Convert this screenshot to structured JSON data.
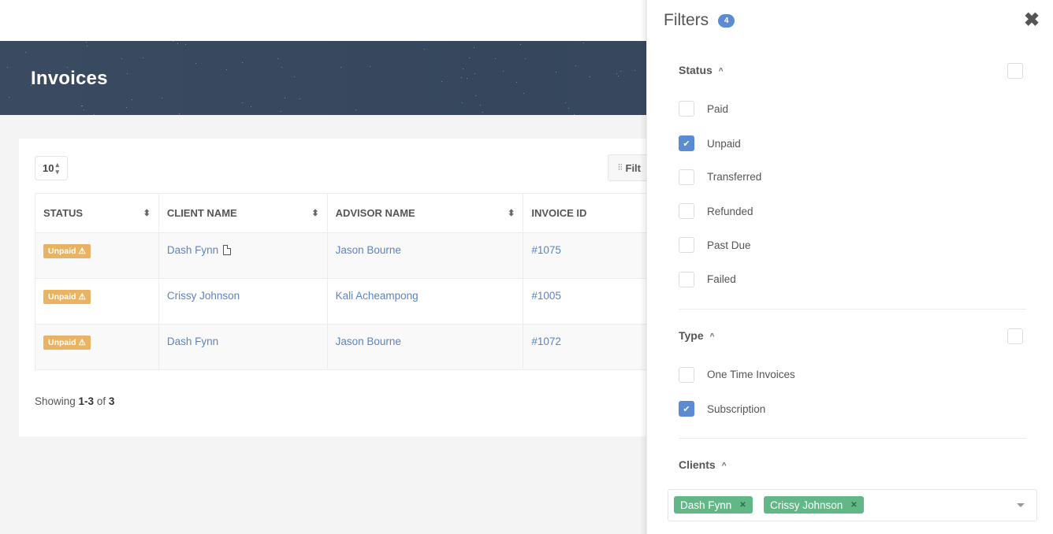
{
  "header": {
    "title": "Invoices"
  },
  "toolbar": {
    "per_page": "10",
    "filter_label": "Filt"
  },
  "table": {
    "columns": [
      "STATUS",
      "CLIENT NAME",
      "ADVISOR NAME",
      "INVOICE ID"
    ],
    "rows": [
      {
        "status": "Unpaid",
        "client": "Dash Fynn",
        "advisor": "Jason Bourne",
        "invoice": "#1075"
      },
      {
        "status": "Unpaid",
        "client": "Crissy Johnson",
        "advisor": "Kali Acheampong",
        "invoice": "#1005"
      },
      {
        "status": "Unpaid",
        "client": "Dash Fynn",
        "advisor": "Jason Bourne",
        "invoice": "#1072"
      }
    ]
  },
  "footer": {
    "showing_prefix": "Showing ",
    "range": "1-3",
    "of": " of ",
    "total": "3"
  },
  "filters": {
    "title": "Filters",
    "count": "4",
    "close_icon": "✖",
    "status": {
      "title": "Status",
      "options": [
        {
          "label": "Paid",
          "checked": false
        },
        {
          "label": "Unpaid",
          "checked": true
        },
        {
          "label": "Transferred",
          "checked": false
        },
        {
          "label": "Refunded",
          "checked": false
        },
        {
          "label": "Past Due",
          "checked": false
        },
        {
          "label": "Failed",
          "checked": false
        }
      ]
    },
    "type": {
      "title": "Type",
      "options": [
        {
          "label": "One Time Invoices",
          "checked": false
        },
        {
          "label": "Subscription",
          "checked": true
        }
      ]
    },
    "clients": {
      "title": "Clients",
      "selected": [
        "Dash Fynn",
        "Crissy Johnson"
      ]
    }
  },
  "colors": {
    "accent": "#5b8bd0",
    "badge_unpaid": "#e9b364",
    "tag": "#62b787",
    "link": "#5b84c4",
    "hero": "#3a4a60"
  }
}
